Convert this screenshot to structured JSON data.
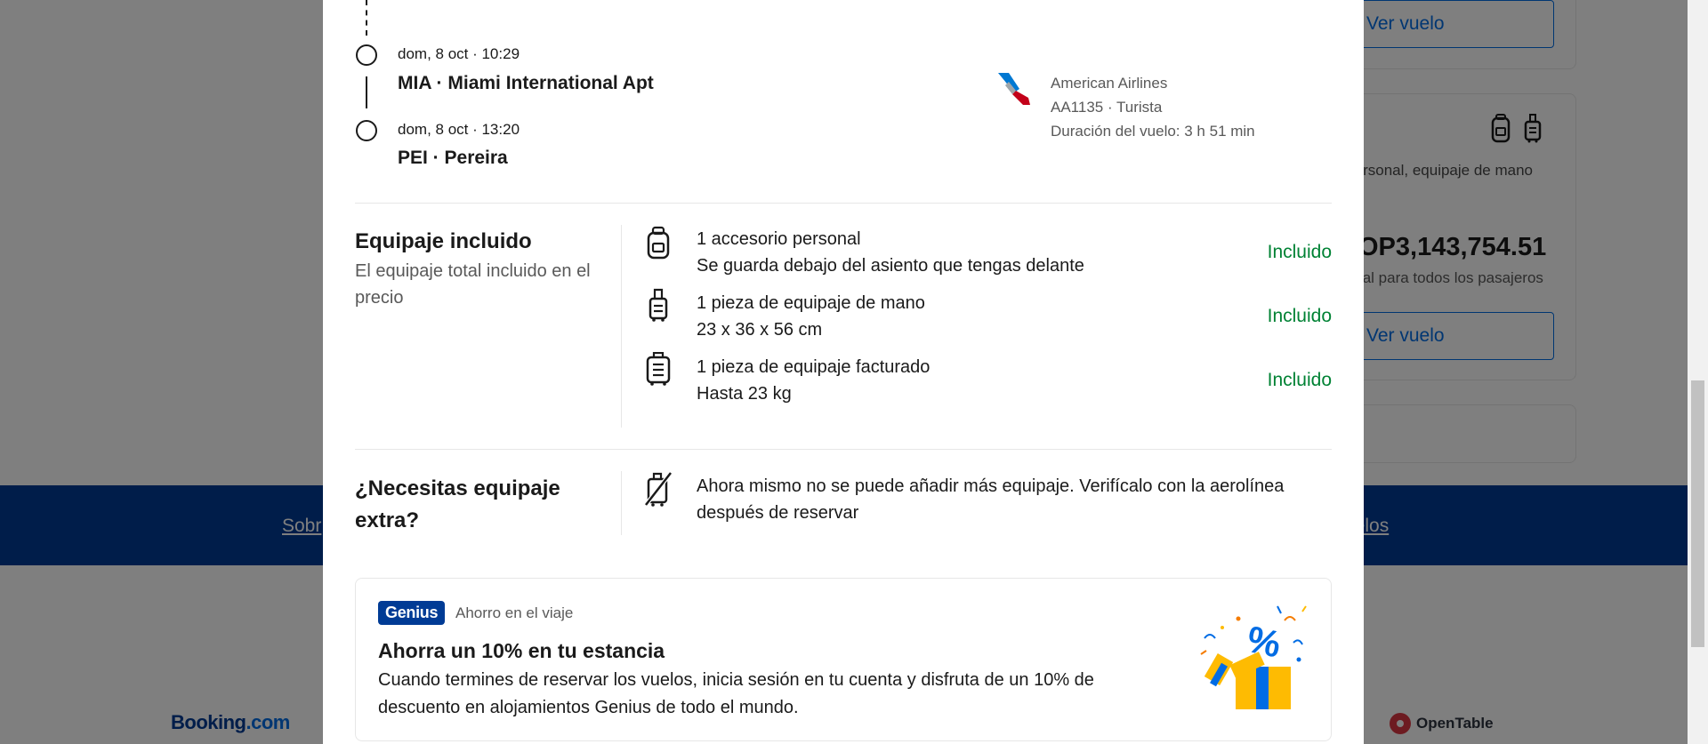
{
  "background": {
    "view_flight_label": "Ver vuelo",
    "bag_summary": "sorio personal, equipaje de mano",
    "price": "OP3,143,754.51",
    "price_note": "tal para todos los pasajeros",
    "footer_link_left": "Sobr",
    "footer_link_right": "uelos",
    "logo_booking_main": "Booking",
    "logo_booking_tld": ".com",
    "logo_opentable": "OpenTable"
  },
  "segment": {
    "departure": {
      "time": "dom, 8 oct · 10:29",
      "airport": "MIA · Miami International Apt"
    },
    "arrival": {
      "time": "dom, 8 oct · 13:20",
      "airport": "PEI · Pereira"
    },
    "airline": {
      "name": "American Airlines",
      "flight": "AA1135 · Turista",
      "duration": "Duración del vuelo: 3 h 51 min",
      "logo_icon": "american-airlines-logo"
    }
  },
  "baggage": {
    "title": "Equipaje incluido",
    "subtitle": "El equipaje total incluido en el precio",
    "items": [
      {
        "icon": "personal-item-icon",
        "name": "1 accesorio personal",
        "detail": "Se guarda debajo del asiento que tengas delante",
        "status": "Incluido"
      },
      {
        "icon": "cabin-bag-icon",
        "name": "1 pieza de equipaje de mano",
        "detail": "23 x 36 x 56 cm",
        "status": "Incluido"
      },
      {
        "icon": "checked-bag-icon",
        "name": "1 pieza de equipaje facturado",
        "detail": "Hasta 23 kg",
        "status": "Incluido"
      }
    ]
  },
  "extra": {
    "title_line1": "¿Necesitas equipaje",
    "title_line2": "extra?",
    "icon": "no-baggage-icon",
    "text": "Ahora mismo no se puede añadir más equipaje. Verifícalo con la aerolínea después de reservar"
  },
  "genius": {
    "badge": "Genius",
    "subtitle": "Ahorro en el viaje",
    "title": "Ahorra un 10% en tu estancia",
    "description": "Cuando termines de reservar los vuelos, inicia sesión en tu cuenta y disfruta de un 10% de descuento en alojamientos Genius de todo el mundo.",
    "illustration": "gift-box-percent-icon"
  },
  "colors": {
    "brand_blue": "#003b95",
    "link_blue": "#006ce4",
    "included_green": "#008234",
    "overlay": "rgba(0,0,0,0.5)"
  }
}
